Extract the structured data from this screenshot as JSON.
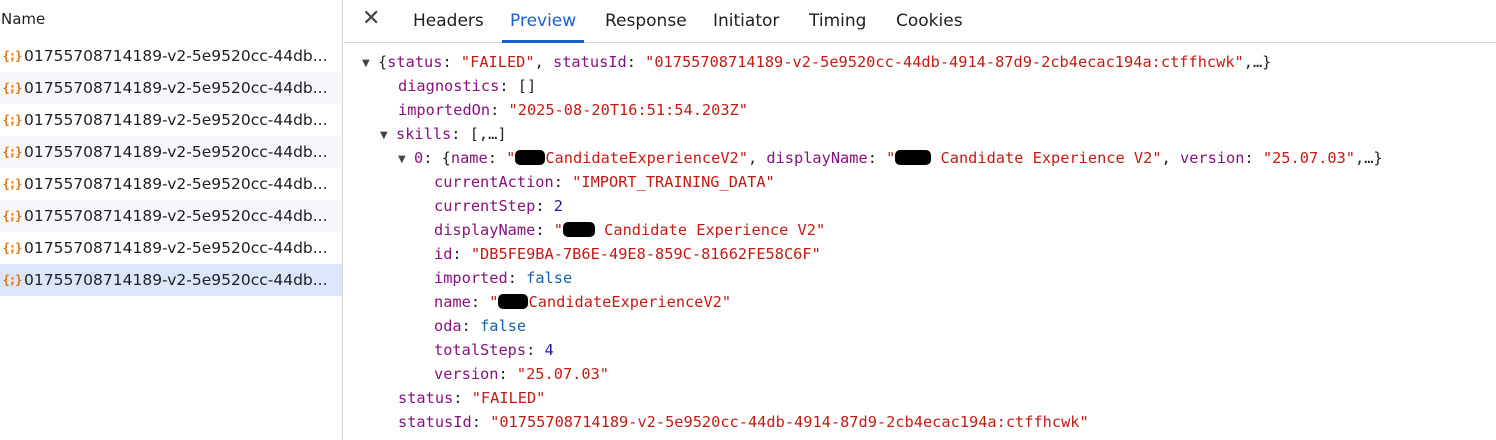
{
  "requests": {
    "header": "Name",
    "icon": "json-icon",
    "icon_glyph": "{;}",
    "items": [
      "01755708714189-v2-5e9520cc-44db...",
      "01755708714189-v2-5e9520cc-44db...",
      "01755708714189-v2-5e9520cc-44db...",
      "01755708714189-v2-5e9520cc-44db...",
      "01755708714189-v2-5e9520cc-44db...",
      "01755708714189-v2-5e9520cc-44db...",
      "01755708714189-v2-5e9520cc-44db...",
      "01755708714189-v2-5e9520cc-44db..."
    ],
    "selected_index": 7
  },
  "tabs": {
    "close_glyph": "✕",
    "items": [
      "Headers",
      "Preview",
      "Response",
      "Initiator",
      "Timing",
      "Cookies"
    ],
    "active": "Preview"
  },
  "preview": {
    "root": {
      "summary_open": "{",
      "summary_status_key": "status",
      "summary_status_val": "\"FAILED\"",
      "summary_statusid_key": "statusId",
      "summary_statusid_val": "\"01755708714189-v2-5e9520cc-44db-4914-87d9-2cb4ecac194a:ctffhcwk\"",
      "summary_tail": ",…}"
    },
    "diagnostics": {
      "key": "diagnostics",
      "value": "[]"
    },
    "importedOn": {
      "key": "importedOn",
      "value": "\"2025-08-20T16:51:54.203Z\""
    },
    "skills": {
      "key": "skills",
      "summary": "[,…]"
    },
    "skill0": {
      "index_key": "0",
      "summary_name_key": "name",
      "summary_name_val_pre": "\"",
      "summary_name_val": "CandidateExperienceV2\"",
      "summary_display_key": "displayName",
      "summary_display_val_pre": "\"",
      "summary_display_val": " Candidate Experience V2\"",
      "summary_version_key": "version",
      "summary_version_val": "\"25.07.03\"",
      "summary_tail": ",…}",
      "fields": {
        "currentAction": {
          "key": "currentAction",
          "value": "\"IMPORT_TRAINING_DATA\""
        },
        "currentStep": {
          "key": "currentStep",
          "value": "2"
        },
        "displayName": {
          "key": "displayName",
          "value_pre": "\"",
          "value": " Candidate Experience V2\""
        },
        "id": {
          "key": "id",
          "value": "\"DB5FE9BA-7B6E-49E8-859C-81662FE58C6F\""
        },
        "imported": {
          "key": "imported",
          "value": "false"
        },
        "name": {
          "key": "name",
          "value_pre": "\"",
          "value": "CandidateExperienceV2\""
        },
        "oda": {
          "key": "oda",
          "value": "false"
        },
        "totalSteps": {
          "key": "totalSteps",
          "value": "4"
        },
        "version": {
          "key": "version",
          "value": "\"25.07.03\""
        }
      }
    },
    "status": {
      "key": "status",
      "value": "\"FAILED\""
    },
    "statusId": {
      "key": "statusId",
      "value": "\"01755708714189-v2-5e9520cc-44db-4914-87d9-2cb4ecac194a:ctffhcwk\""
    }
  },
  "colors": {
    "key": "#881280",
    "string": "#c41a16",
    "number": "#1a1aa6",
    "boolean": "#1a5fa6",
    "active_tab": "#1a5fd0",
    "icon": "#e8710a",
    "selected_row": "#dbe6fa"
  }
}
